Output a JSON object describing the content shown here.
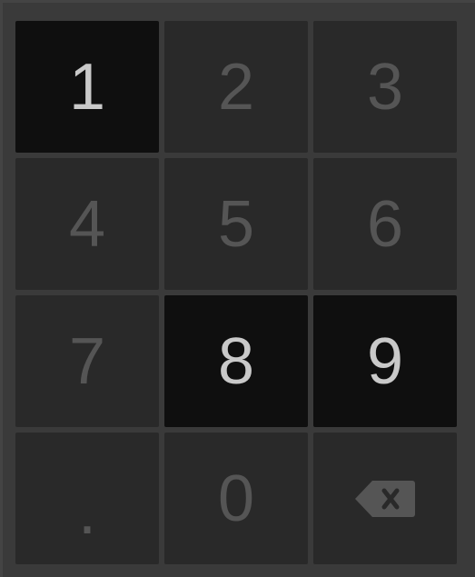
{
  "keypad": {
    "keys": [
      {
        "label": "1",
        "active": true
      },
      {
        "label": "2",
        "active": false
      },
      {
        "label": "3",
        "active": false
      },
      {
        "label": "4",
        "active": false
      },
      {
        "label": "5",
        "active": false
      },
      {
        "label": "6",
        "active": false
      },
      {
        "label": "7",
        "active": false
      },
      {
        "label": "8",
        "active": true
      },
      {
        "label": "9",
        "active": true
      },
      {
        "label": ".",
        "active": false
      },
      {
        "label": "0",
        "active": false
      }
    ],
    "backspace_icon": "backspace-icon"
  },
  "colors": {
    "background": "#3a3a3a",
    "key_inactive": "#292929",
    "key_active": "#0f0f0f",
    "text_inactive": "#555555",
    "text_active": "#c9c9c9"
  }
}
